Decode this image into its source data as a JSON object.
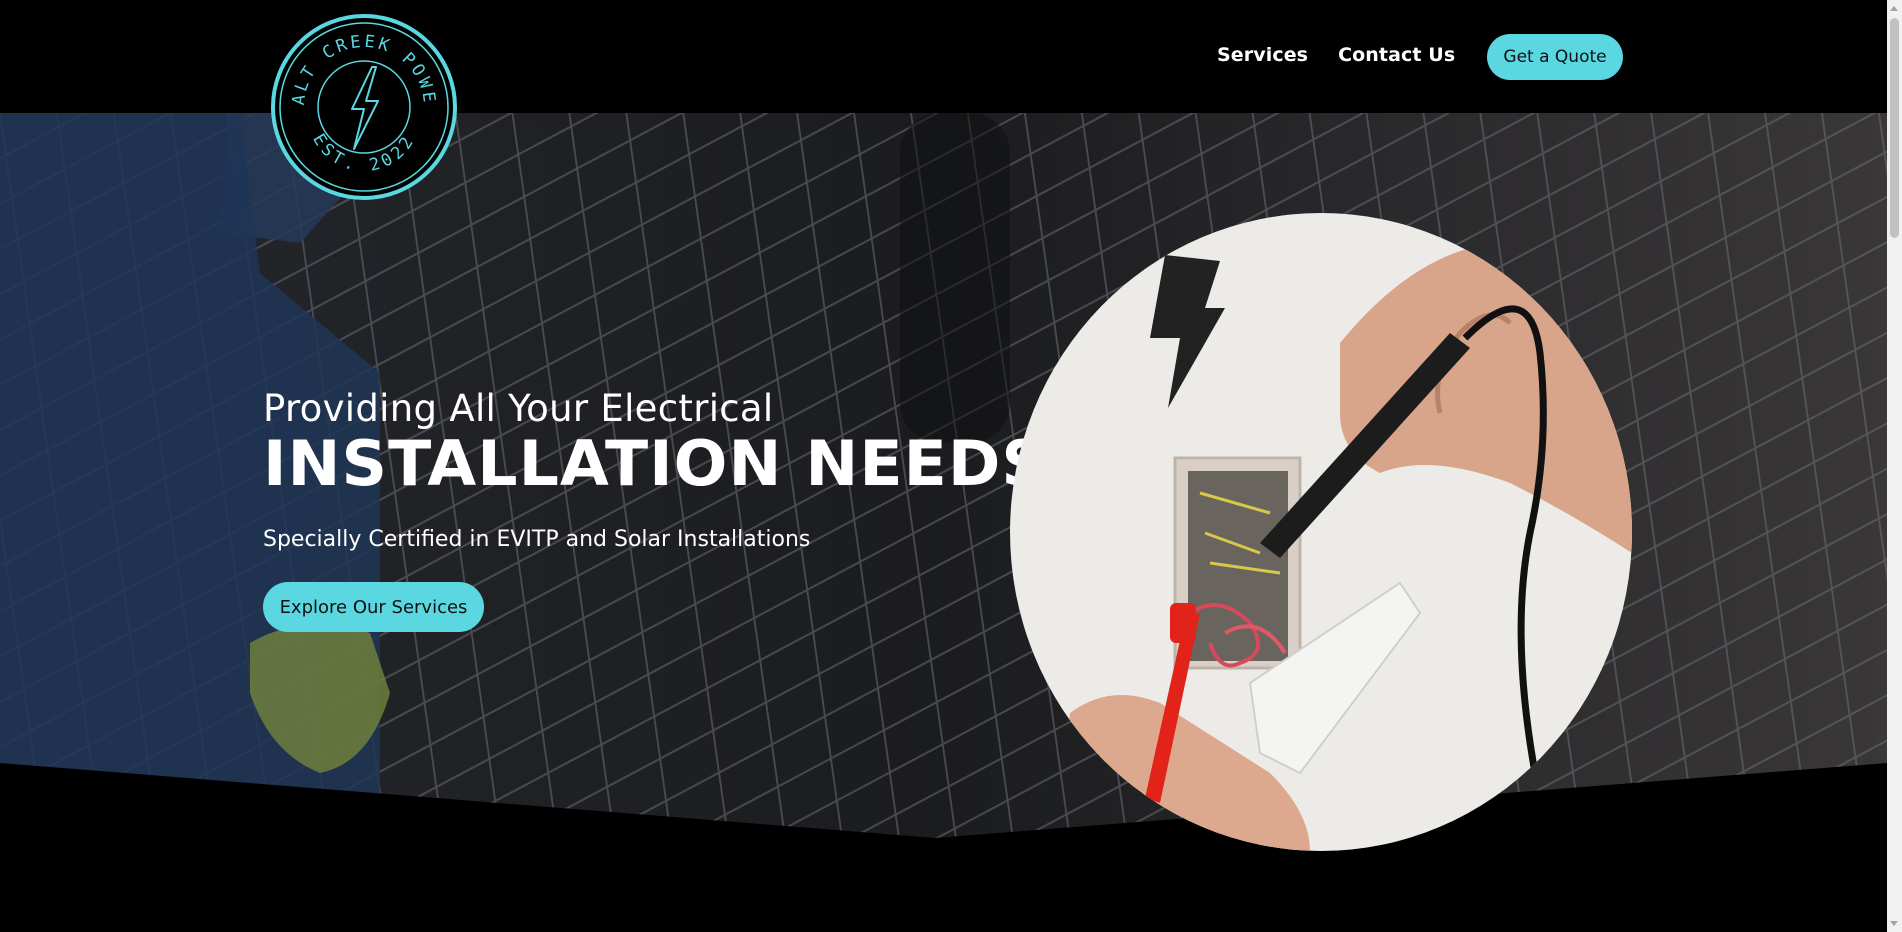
{
  "brand": {
    "logo_top_text": "SALT CREEK POWER",
    "logo_bottom_text": "EST. 2022",
    "accent_color": "#5ad7e1"
  },
  "nav": {
    "items": [
      {
        "label": "Services"
      },
      {
        "label": "Contact Us"
      }
    ],
    "quote_label": "Get a Quote"
  },
  "hero": {
    "line1": "Providing All Your Electrical",
    "line2": "INSTALLATION NEEDS",
    "subtitle": "Specially Certified in EVITP and Solar Installations",
    "cta_label": "Explore Our Services",
    "background_image": "solar-panel-worker-photo",
    "feature_image": "electrician-testing-wires-photo"
  }
}
